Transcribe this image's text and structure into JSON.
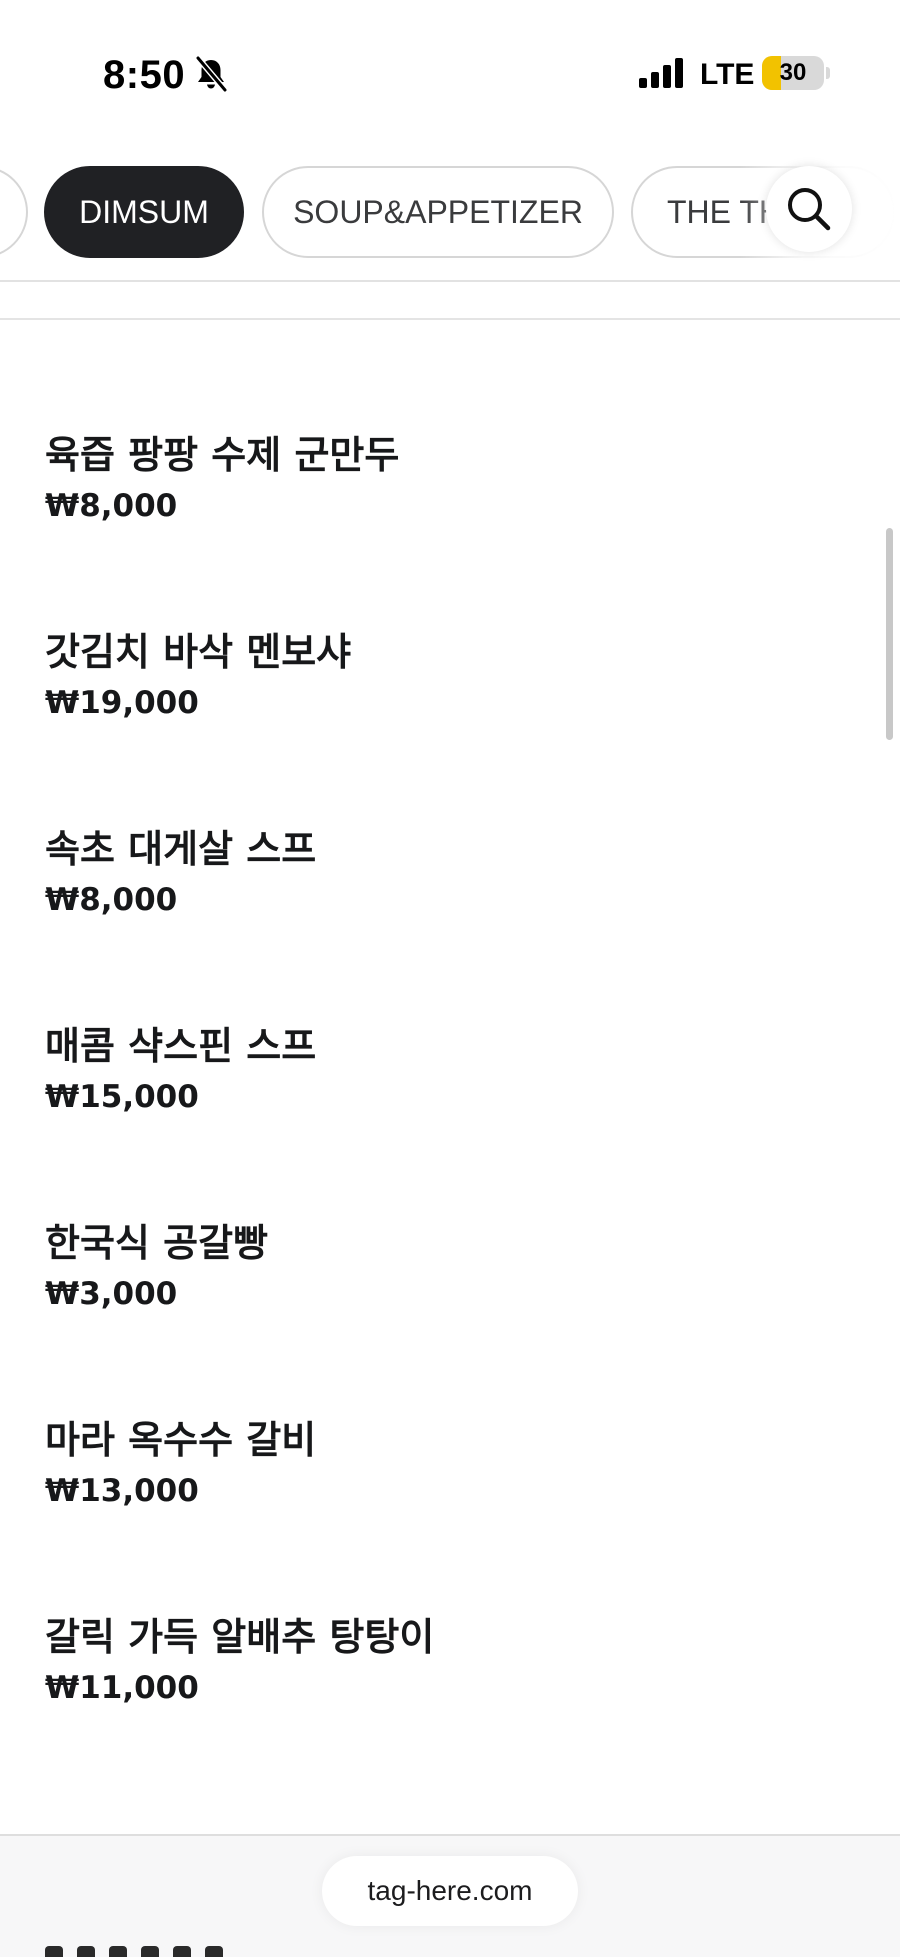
{
  "status_bar": {
    "time": "8:50",
    "network": "LTE",
    "battery_level": "30",
    "battery_fraction": 0.3,
    "icons": [
      "bell-slash-icon",
      "cellular-signal-icon",
      "battery-icon"
    ]
  },
  "category_tabs": {
    "items": [
      {
        "label": "DIMSUM",
        "active": true
      },
      {
        "label": "SOUP&APPETIZER",
        "active": false
      },
      {
        "label": "THE TH",
        "active": false
      }
    ],
    "search_icon": "search-icon"
  },
  "menu": {
    "items": [
      {
        "name": "육즙 팡팡 수제 군만두",
        "price": "₩8,000"
      },
      {
        "name": "갓김치 바삭 멘보샤",
        "price": "₩19,000"
      },
      {
        "name": "속초 대게살 스프",
        "price": "₩8,000"
      },
      {
        "name": "매콤 샥스핀 스프",
        "price": "₩15,000"
      },
      {
        "name": "한국식 공갈빵",
        "price": "₩3,000"
      },
      {
        "name": "마라 옥수수 갈비",
        "price": "₩13,000"
      },
      {
        "name": "갈릭 가득 알배추 탕탕이",
        "price": "₩11,000"
      }
    ]
  },
  "browser": {
    "url": "tag-here.com"
  },
  "colors": {
    "text": "#17181a",
    "active_tab_bg": "#202124",
    "tab_border": "#d6d6d6",
    "battery_fill": "#f2c200"
  }
}
